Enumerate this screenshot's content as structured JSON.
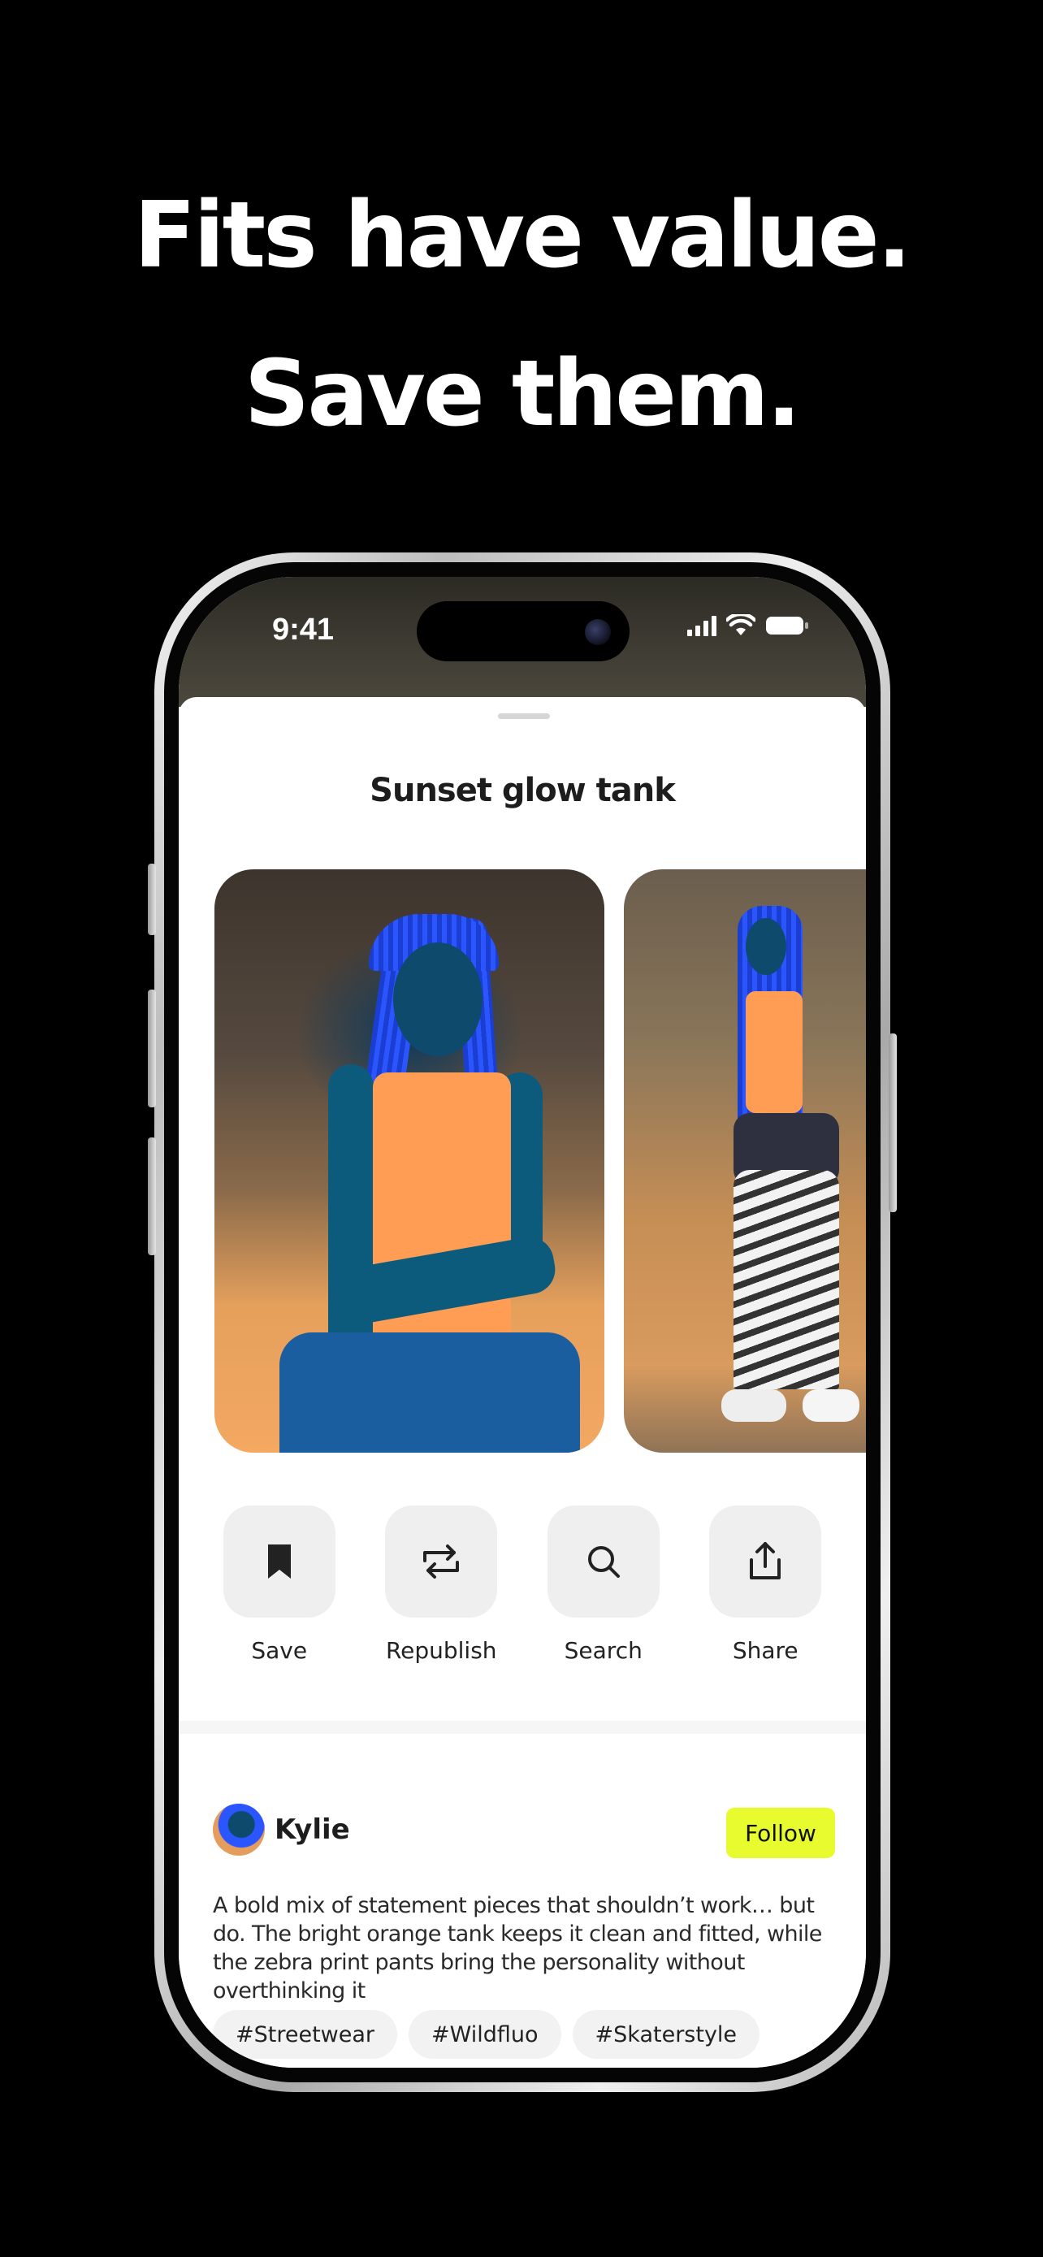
{
  "marketing": {
    "headline_line1": "Fits have value.",
    "headline_line2": "Save them."
  },
  "status_bar": {
    "time": "9:41",
    "icons": [
      "cellular-signal-icon",
      "wifi-icon",
      "battery-icon"
    ]
  },
  "sheet": {
    "title": "Sunset glow tank"
  },
  "gallery": {
    "images": [
      "outfit-photo-front",
      "outfit-photo-full-body"
    ]
  },
  "actions": [
    {
      "label": "Save",
      "icon": "bookmark-icon"
    },
    {
      "label": "Republish",
      "icon": "repost-icon"
    },
    {
      "label": "Search",
      "icon": "search-icon"
    },
    {
      "label": "Share",
      "icon": "share-icon"
    }
  ],
  "author": {
    "name": "Kylie",
    "follow_label": "Follow"
  },
  "post": {
    "description": "A bold mix of statement pieces that shouldn’t work… but do. The bright orange tank keeps it clean and fitted, while the zebra print pants bring the personality without overthinking it"
  },
  "tags": [
    "#Streetwear",
    "#Wildfluo",
    "#Skaterstyle"
  ],
  "colors": {
    "background": "#000000",
    "follow_button": "#E7FB2F",
    "action_tile": "#EFEFEF",
    "headline_text": "#FFFFFF"
  }
}
